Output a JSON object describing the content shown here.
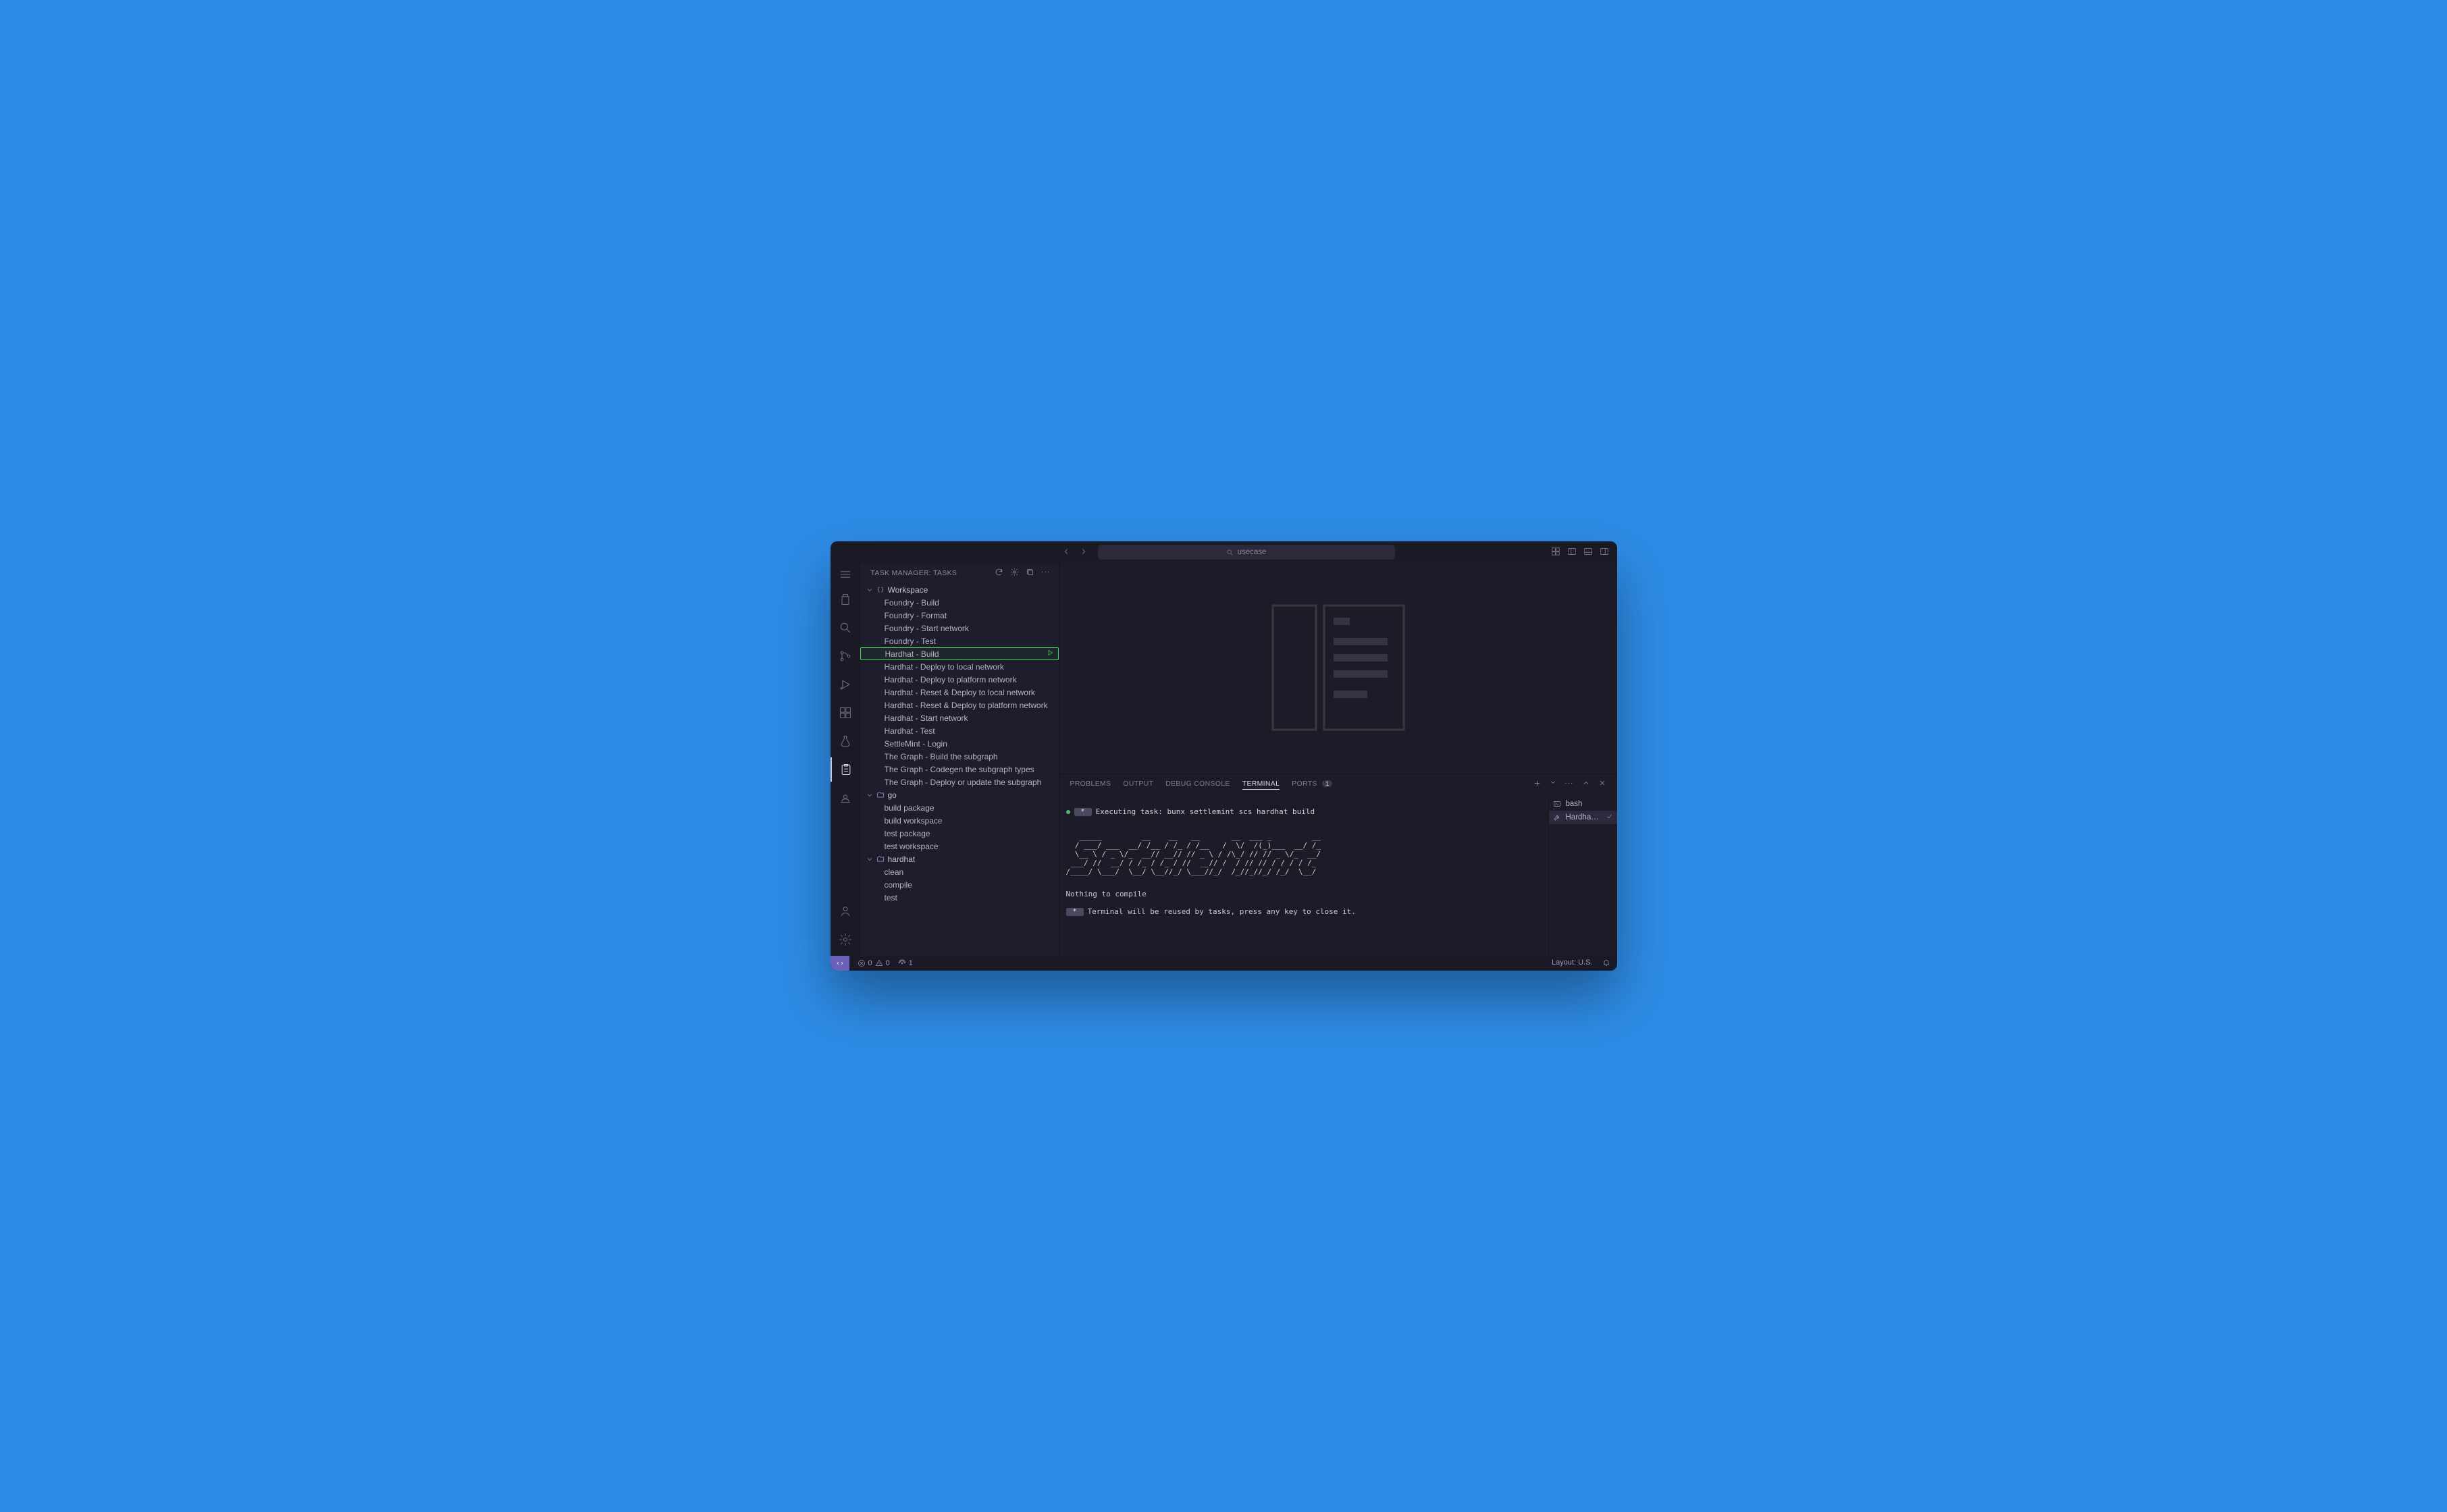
{
  "titlebar": {
    "search_placeholder": "usecase",
    "nav_back_icon": "arrow-left",
    "nav_fwd_icon": "arrow-right"
  },
  "sidebar": {
    "title": "Task Manager: Tasks",
    "groups": [
      {
        "icon": "braces",
        "label": "Workspace",
        "tasks": [
          "Foundry - Build",
          "Foundry - Format",
          "Foundry - Start network",
          "Foundry - Test",
          "Hardhat - Build",
          "Hardhat - Deploy to local network",
          "Hardhat - Deploy to platform network",
          "Hardhat - Reset & Deploy to local network",
          "Hardhat - Reset & Deploy to platform network",
          "Hardhat - Start network",
          "Hardhat - Test",
          "SettleMint - Login",
          "The Graph - Build the subgraph",
          "The Graph - Codegen the subgraph types",
          "The Graph - Deploy or update the subgraph"
        ],
        "selected_index": 4
      },
      {
        "icon": "folder",
        "label": "go",
        "tasks": [
          "build package",
          "build workspace",
          "test package",
          "test workspace"
        ]
      },
      {
        "icon": "folder",
        "label": "hardhat",
        "tasks": [
          "clean",
          "compile",
          "test"
        ]
      }
    ]
  },
  "panel": {
    "tabs": {
      "problems": "Problems",
      "output": "Output",
      "debug": "Debug Console",
      "terminal": "Terminal",
      "ports": "Ports",
      "ports_count": "1"
    },
    "terminal": {
      "exec_prefix": "Executing task:",
      "exec_cmd": "bunx settlemint scs hardhat build",
      "ascii": "   _____         __    __   __       __  ___ _         __ \n  / ___/ ___  __/ /__ / /_ / /__   /  \\/  /(_)___  __/ /_\n  \\__ \\ / _ \\/_  __// __// // _ \\ / /\\_/ // // _ \\/_  __/\n ___/ //  __/ / /_ / /_ / //  __// /  / // // / / / / /_ \n/____/ \\___/  \\__/ \\__//_/ \\___//_/  /_//_//_/ /_/  \\__/ ",
      "msg1": "Nothing to compile",
      "msg2_prefix": " *  ",
      "msg2": "Terminal will be reused by tasks, press any key to close it."
    },
    "side_items": [
      {
        "icon": "terminal",
        "label": "bash",
        "active": false
      },
      {
        "icon": "wrench",
        "label": "Hardha…",
        "active": true,
        "check": true
      }
    ]
  },
  "statusbar": {
    "errors": "0",
    "warnings": "0",
    "radio": "1",
    "layout": "Layout: U.S."
  }
}
